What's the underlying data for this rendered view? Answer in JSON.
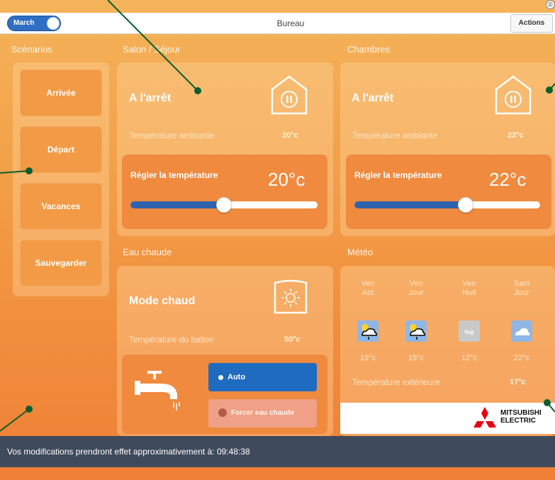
{
  "header": {
    "toggle_label": "March",
    "title": "Bureau",
    "actions_label": "Actions",
    "actions_badge": "©"
  },
  "scenarios": {
    "title": "Scénarios",
    "items": [
      {
        "label": "Arrivée"
      },
      {
        "label": "Départ"
      },
      {
        "label": "Vacances"
      },
      {
        "label": "Sauvegarder"
      }
    ]
  },
  "salon": {
    "title": "Salon / Séjour",
    "state": "A l'arrêt",
    "ambient_label": "Température ambiante",
    "ambient_value": "20°c",
    "set_label": "Régler la température",
    "set_value": "20°c",
    "slider_fraction": 0.5
  },
  "chambres": {
    "title": "Chambres",
    "state": "A l'arrêt",
    "ambient_label": "Température ambiante",
    "ambient_value": "22°c",
    "set_label": "Régler la température",
    "set_value": "22°c",
    "slider_fraction": 0.6
  },
  "eau": {
    "title": "Eau chaude",
    "mode": "Mode chaud",
    "tank_label": "Température du ballon",
    "tank_value": "50°c",
    "auto_label": "Auto",
    "force_label": "Forcer eau chaude"
  },
  "meteo": {
    "title": "Météo",
    "days": [
      {
        "line1": "Ven",
        "line2": "Act",
        "icon": "sun-cloud-rain-icon",
        "temp": "19°c"
      },
      {
        "line1": "Ven",
        "line2": "Jour",
        "icon": "sun-cloud-rain-icon",
        "temp": "19°c"
      },
      {
        "line1": "Ven",
        "line2": "Nuit",
        "icon": "fog-icon",
        "temp": "12°c"
      },
      {
        "line1": "Sam",
        "line2": "Jour",
        "icon": "cloud-icon",
        "temp": "22°c"
      }
    ],
    "fog_text": "fog",
    "ext_label": "Température extérieure",
    "ext_value": "17°c",
    "logo_line1": "MITSUBISHI",
    "logo_line2": "ELECTRIC"
  },
  "footer": {
    "message": "Vos modifications prendront effet approximativement à: 09:48:38"
  },
  "colors": {
    "accent_blue": "#2f63ad",
    "orange_bg": "#f29a45",
    "footer_bg": "#3f4a5c",
    "annotation_green": "#0b5e2f"
  }
}
